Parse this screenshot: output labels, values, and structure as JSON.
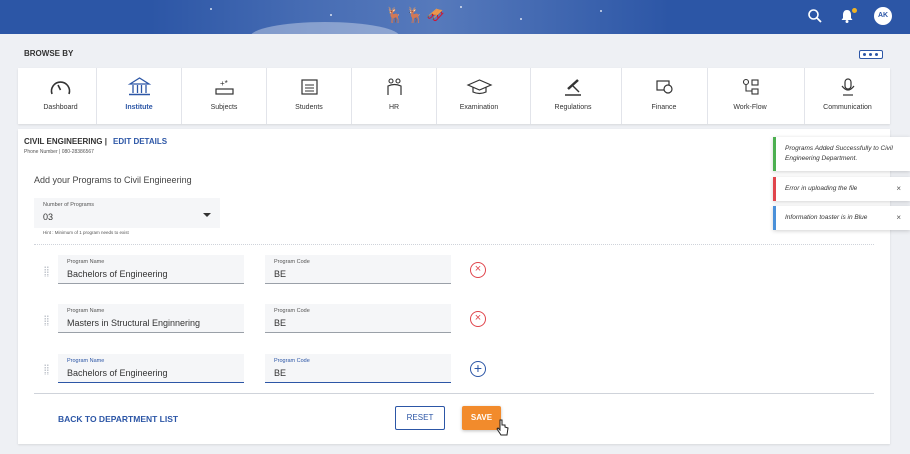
{
  "header": {
    "avatar_initials": "AK",
    "icons": [
      "search-icon",
      "bell-icon"
    ],
    "accent": "#2c56a6"
  },
  "browse": {
    "title": "BROWSE BY",
    "nav_items": [
      {
        "label": "Dashboard",
        "icon": "gauge-icon"
      },
      {
        "label": "Institute",
        "icon": "institute-icon",
        "active": true
      },
      {
        "label": "Subjects",
        "icon": "subjects-icon"
      },
      {
        "label": "Students",
        "icon": "students-icon"
      },
      {
        "label": "HR",
        "icon": "hr-icon"
      },
      {
        "label": "Examination",
        "icon": "graduation-cap-icon"
      },
      {
        "label": "Regulations",
        "icon": "gavel-icon"
      },
      {
        "label": "Finance",
        "icon": "finance-icon"
      },
      {
        "label": "Work-Flow",
        "icon": "workflow-icon"
      },
      {
        "label": "Communication",
        "icon": "microphone-icon"
      }
    ]
  },
  "department": {
    "name": "CIVIL ENGINEERING  |",
    "edit_label": "EDIT DETAILS",
    "phone": "Phone Number | 080-28386567"
  },
  "form": {
    "section_title": "Add your Programs to Civil Engineering",
    "num_programs_label": "Number of Programs",
    "num_programs_value": "03",
    "hint": "Hint : Minimum of 1 program needs to exist",
    "programs": [
      {
        "name_label": "Program Name",
        "name": "Bachelors of Engineering",
        "code_label": "Program Code",
        "code": "BE",
        "action": "remove"
      },
      {
        "name_label": "Program Name",
        "name": "Masters in Structural Enginnering",
        "code_label": "Program Code",
        "code": "BE",
        "action": "remove"
      },
      {
        "name_label": "Program Name",
        "name": "Bachelors of Engineering",
        "code_label": "Program Code",
        "code": "BE",
        "action": "add"
      }
    ]
  },
  "footer": {
    "back_label": "BACK TO  DEPARTMENT LIST",
    "reset_label": "RESET",
    "save_label": "SAVE"
  },
  "toasts": [
    {
      "text": "Programs Added Successfully to Civil Engineering Department.",
      "color": "#4caf50"
    },
    {
      "text": "Error in uploading the file",
      "color": "#e0454c"
    },
    {
      "text": "Information toaster is in Blue",
      "color": "#4a90d9"
    }
  ]
}
